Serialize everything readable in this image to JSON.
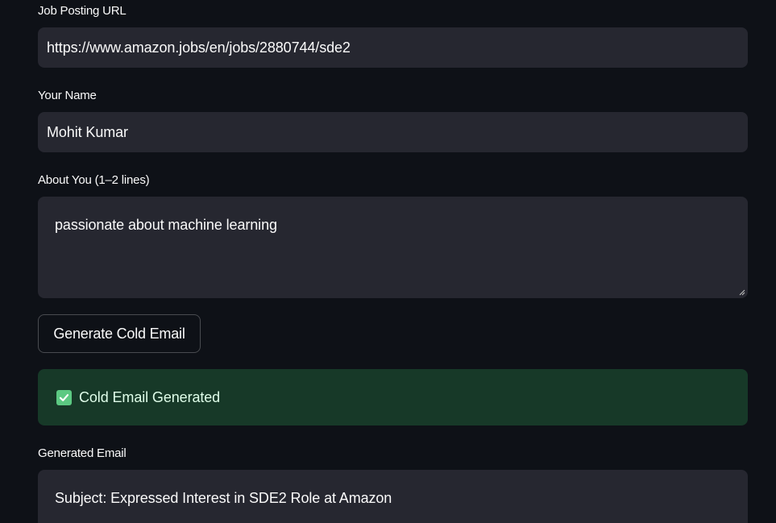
{
  "form": {
    "job_url": {
      "label": "Job Posting URL",
      "value": "https://www.amazon.jobs/en/jobs/2880744/sde2"
    },
    "name": {
      "label": "Your Name",
      "value": "Mohit Kumar"
    },
    "about": {
      "label": "About You (1–2 lines)",
      "value": "passionate about machine learning"
    },
    "generate_button": "Generate Cold Email"
  },
  "status": {
    "icon": "check-mark-icon",
    "message": "Cold Email Generated",
    "color": "#173928",
    "icon_color": "#5cc982"
  },
  "output": {
    "label": "Generated Email",
    "text": "Subject: Expressed Interest in SDE2 Role at Amazon"
  },
  "theme": {
    "background": "#0e1117",
    "field_background": "#262730",
    "text": "#fafafa"
  }
}
